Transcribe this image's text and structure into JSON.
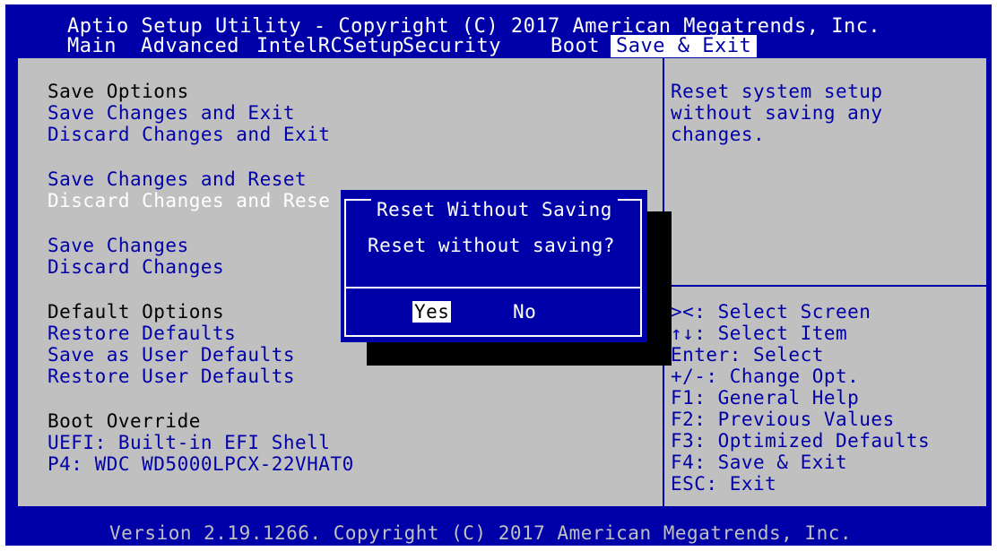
{
  "header": {
    "title": "Aptio Setup Utility - Copyright (C) 2017 American Megatrends, Inc.",
    "tabs": [
      "Main",
      "Advanced",
      "IntelRCSetup",
      "Security",
      "Boot"
    ],
    "active_tab": "Save & Exit"
  },
  "menu": {
    "save_options_heading": "Save Options",
    "save_changes_and_exit": "Save Changes and Exit",
    "discard_changes_and_exit": "Discard Changes and Exit",
    "save_changes_and_reset": "Save Changes and Reset",
    "discard_changes_and_reset": "Discard Changes and Rese",
    "save_changes": "Save Changes",
    "discard_changes": "Discard Changes",
    "default_options_heading": "Default Options",
    "restore_defaults": "Restore Defaults",
    "save_as_user_defaults": "Save as User Defaults",
    "restore_user_defaults": "Restore User Defaults",
    "boot_override_heading": "Boot Override",
    "uefi_shell": "UEFI: Built-in EFI Shell",
    "p4_drive": "P4: WDC WD5000LPCX-22VHAT0"
  },
  "help": {
    "line1": "Reset system setup",
    "line2": "without saving any",
    "line3": "changes."
  },
  "keys": [
    "><: Select Screen",
    "↑↓: Select Item",
    "Enter: Select",
    "+/-: Change Opt.",
    "F1: General Help",
    "F2: Previous Values",
    "F3: Optimized Defaults",
    "F4: Save & Exit",
    "ESC: Exit"
  ],
  "dialog": {
    "title": "Reset Without Saving",
    "message": "Reset without saving?",
    "yes": "Yes",
    "no": "No"
  },
  "footer": "Version 2.19.1266. Copyright (C) 2017 American Megatrends, Inc.",
  "colors": {
    "background": "#0000a8",
    "panel": "#c0c0c0",
    "highlight": "#ffffff"
  }
}
